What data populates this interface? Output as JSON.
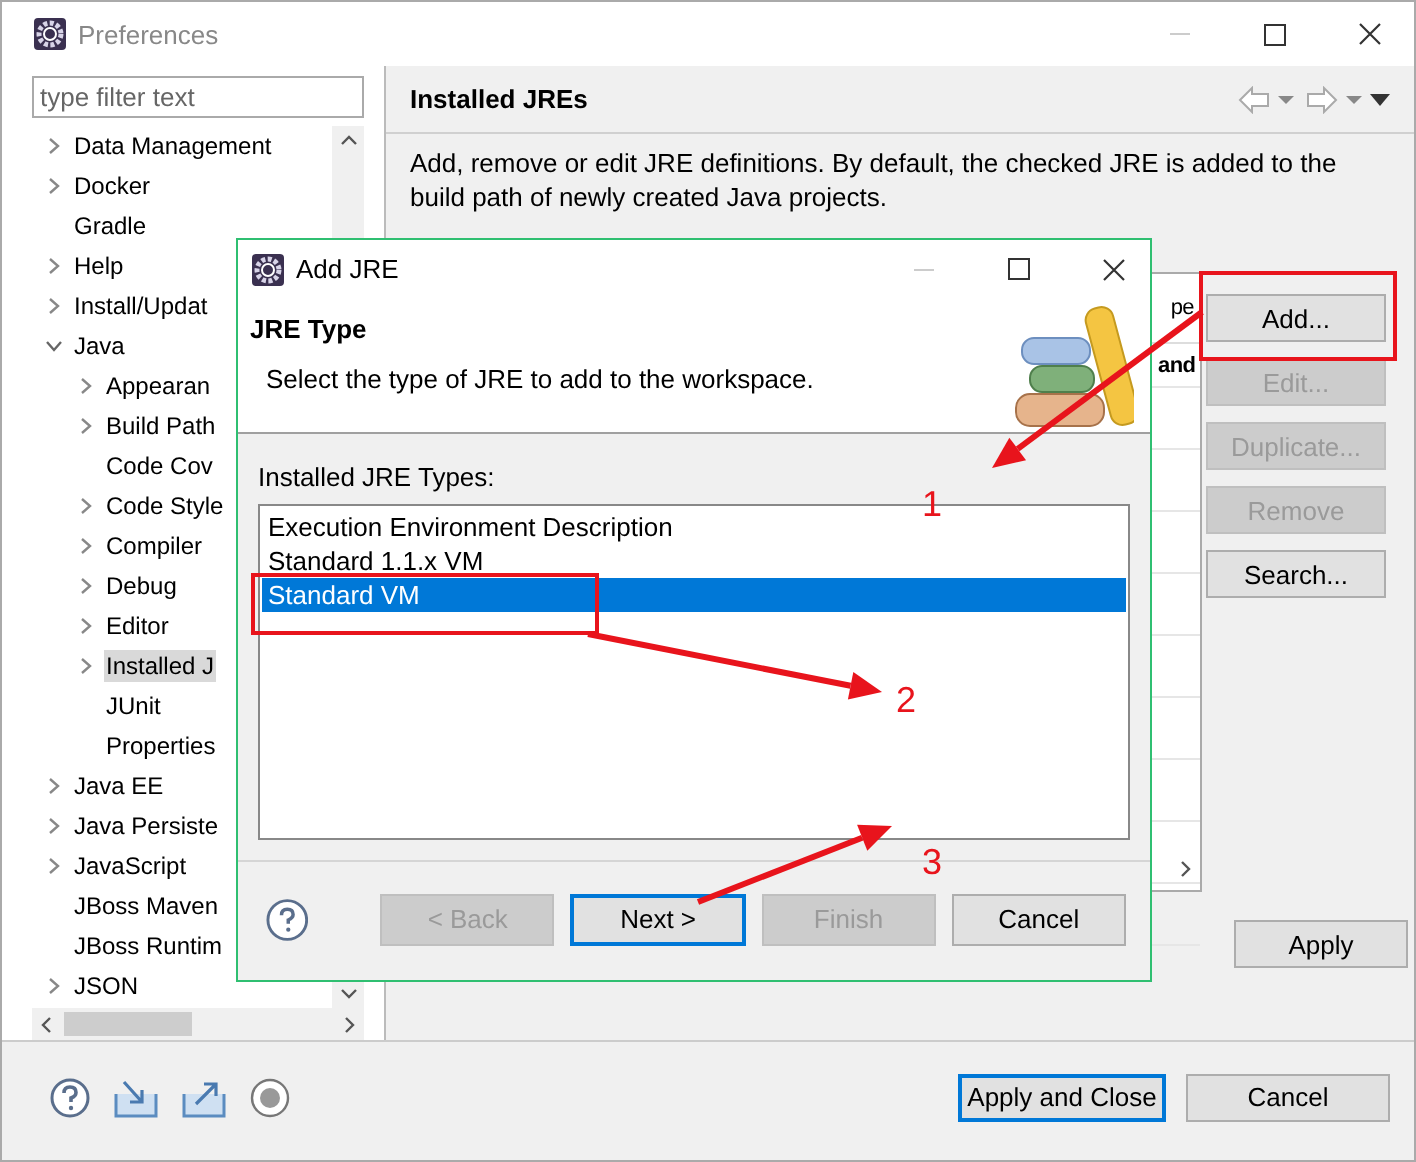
{
  "window": {
    "title": "Preferences"
  },
  "sidebar": {
    "filter": {
      "placeholder": "type filter text"
    },
    "tree": [
      {
        "label": "Data Management",
        "kind": "folder",
        "expanded": false,
        "selected": false
      },
      {
        "label": "Docker",
        "kind": "folder",
        "expanded": false,
        "selected": false
      },
      {
        "label": "Gradle",
        "kind": "leaf",
        "selected": false
      },
      {
        "label": "Help",
        "kind": "folder",
        "expanded": false,
        "selected": false
      },
      {
        "label": "Install/Updat",
        "kind": "folder",
        "expanded": false,
        "selected": false
      },
      {
        "label": "Java",
        "kind": "folder",
        "expanded": true,
        "selected": false,
        "children": [
          {
            "label": "Appearan",
            "kind": "folder",
            "expanded": false,
            "selected": false
          },
          {
            "label": "Build Path",
            "kind": "folder",
            "expanded": false,
            "selected": false
          },
          {
            "label": "Code Cov",
            "kind": "leaf",
            "selected": false
          },
          {
            "label": "Code Style",
            "kind": "folder",
            "expanded": false,
            "selected": false
          },
          {
            "label": "Compiler",
            "kind": "folder",
            "expanded": false,
            "selected": false
          },
          {
            "label": "Debug",
            "kind": "folder",
            "expanded": false,
            "selected": false
          },
          {
            "label": "Editor",
            "kind": "folder",
            "expanded": false,
            "selected": false
          },
          {
            "label": "Installed J",
            "kind": "folder",
            "expanded": false,
            "selected": true
          },
          {
            "label": "JUnit",
            "kind": "leaf",
            "selected": false
          },
          {
            "label": "Properties",
            "kind": "leaf",
            "selected": false
          }
        ]
      },
      {
        "label": "Java EE",
        "kind": "folder",
        "expanded": false,
        "selected": false
      },
      {
        "label": "Java Persiste",
        "kind": "folder",
        "expanded": false,
        "selected": false
      },
      {
        "label": "JavaScript",
        "kind": "folder",
        "expanded": false,
        "selected": false
      },
      {
        "label": "JBoss Maven",
        "kind": "leaf",
        "selected": false
      },
      {
        "label": "JBoss Runtim",
        "kind": "leaf",
        "selected": false
      },
      {
        "label": "JSON",
        "kind": "folder",
        "expanded": false,
        "selected": false
      }
    ]
  },
  "page": {
    "title": "Installed JREs",
    "description": "Add, remove or edit JRE definitions. By default, the checked JRE is added to the build path of newly created Java projects.",
    "table": {
      "header_fragment": "pe",
      "row_fragment": "and"
    },
    "buttons": [
      {
        "label": "Add...",
        "disabled": false
      },
      {
        "label": "Edit...",
        "disabled": true
      },
      {
        "label": "Duplicate...",
        "disabled": true
      },
      {
        "label": "Remove",
        "disabled": true
      },
      {
        "label": "Search...",
        "disabled": false
      }
    ],
    "apply": "Apply"
  },
  "footer": {
    "buttons": [
      {
        "label": "Apply and Close",
        "focused": true
      },
      {
        "label": "Cancel",
        "focused": false
      }
    ]
  },
  "dialog": {
    "title": "Add JRE",
    "heading": "JRE Type",
    "description": "Select the type of JRE to add to the workspace.",
    "list_label": "Installed JRE Types:",
    "types": [
      {
        "label": "Execution Environment Description",
        "selected": false
      },
      {
        "label": "Standard 1.1.x VM",
        "selected": false
      },
      {
        "label": "Standard VM",
        "selected": true
      }
    ],
    "buttons": [
      {
        "label": "< Back",
        "disabled": true,
        "focused": false
      },
      {
        "label": "Next >",
        "disabled": false,
        "focused": true
      },
      {
        "label": "Finish",
        "disabled": true,
        "focused": false
      },
      {
        "label": "Cancel",
        "disabled": false,
        "focused": false
      }
    ]
  },
  "annotations": {
    "labels": [
      "1",
      "2",
      "3"
    ]
  }
}
